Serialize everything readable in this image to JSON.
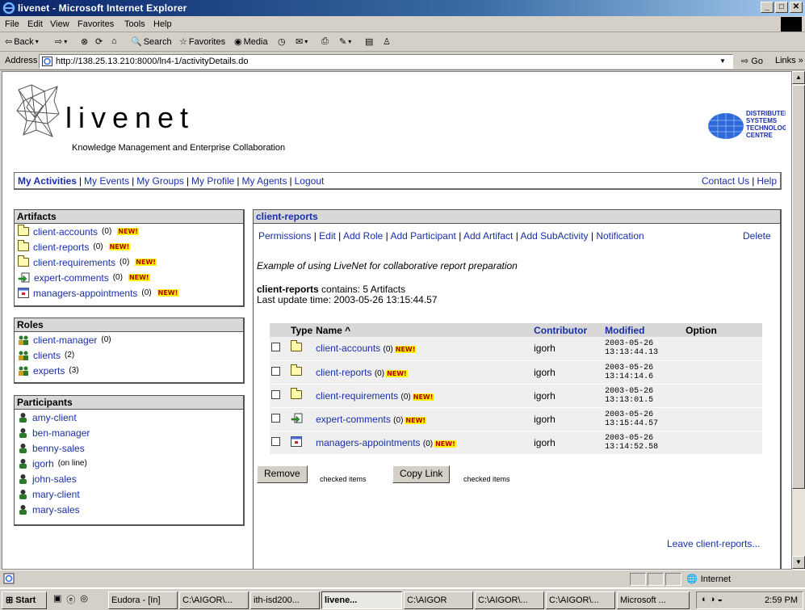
{
  "window": {
    "title": "livenet - Microsoft Internet Explorer",
    "buttons": [
      "_",
      "□",
      "✕"
    ]
  },
  "menu": [
    "File",
    "Edit",
    "View",
    "Favorites",
    "Tools",
    "Help"
  ],
  "toolbar": {
    "back": "Back",
    "search": "Search",
    "favorites": "Favorites",
    "media": "Media"
  },
  "address": {
    "label": "Address",
    "url": "http://138.25.13.210:8000/ln4-1/activityDetails.do",
    "go": "Go",
    "links": "Links »"
  },
  "brand": {
    "name": "livenet",
    "tagline": "Knowledge Management and Enterprise Collaboration",
    "partner": [
      "DISTRIBUTED",
      "SYSTEMS",
      "TECHNOLOGY",
      "CENTRE"
    ]
  },
  "nav": {
    "items": [
      "My Activities",
      "My Events",
      "My Groups",
      "My Profile",
      "My Agents",
      "Logout"
    ],
    "right": [
      "Contact Us",
      "Help"
    ]
  },
  "artifacts": {
    "title": "Artifacts",
    "items": [
      {
        "name": "client-accounts",
        "count": "(0)",
        "badge": "NEW!",
        "icon": "folder-icon"
      },
      {
        "name": "client-reports",
        "count": "(0)",
        "badge": "NEW!",
        "icon": "folder-icon"
      },
      {
        "name": "client-requirements",
        "count": "(0)",
        "badge": "NEW!",
        "icon": "folder-icon"
      },
      {
        "name": "expert-comments",
        "count": "(0)",
        "badge": "NEW!",
        "icon": "arrow-icon"
      },
      {
        "name": "managers-appointments",
        "count": "(0)",
        "badge": "NEW!",
        "icon": "calendar-icon"
      }
    ]
  },
  "roles": {
    "title": "Roles",
    "items": [
      {
        "name": "client-manager",
        "count": "(0)"
      },
      {
        "name": "clients",
        "count": "(2)"
      },
      {
        "name": "experts",
        "count": "(3)"
      }
    ]
  },
  "participants": {
    "title": "Participants",
    "items": [
      {
        "name": "amy-client",
        "note": ""
      },
      {
        "name": "ben-manager",
        "note": ""
      },
      {
        "name": "benny-sales",
        "note": ""
      },
      {
        "name": "igorh",
        "note": "(on line)"
      },
      {
        "name": "john-sales",
        "note": ""
      },
      {
        "name": "mary-client",
        "note": ""
      },
      {
        "name": "mary-sales",
        "note": ""
      }
    ]
  },
  "activity": {
    "title": "client-reports",
    "actions": [
      "Permissions",
      "Edit",
      "Add Role",
      "Add Participant",
      "Add Artifact",
      "Add SubActivity",
      "Notification"
    ],
    "delete": "Delete",
    "description": "Example of using LiveNet for collaborative report preparation",
    "contains_name": "client-reports",
    "contains_text": "contains: 5 Artifacts",
    "last_update": "Last update time: 2003-05-26 13:15:44.57",
    "leave": "Leave client-reports..."
  },
  "table": {
    "headers": [
      "Type",
      "Name ^",
      "Contributor",
      "Modified",
      "Option"
    ],
    "rows": [
      {
        "name": "client-accounts",
        "count": "(0)",
        "badge": "NEW!",
        "contributor": "igorh",
        "date": "2003-05-26",
        "time": "13:13:44.13",
        "icon": "folder-icon"
      },
      {
        "name": "client-reports",
        "count": "(0)",
        "badge": "NEW!",
        "contributor": "igorh",
        "date": "2003-05-26",
        "time": "13:14:14.6",
        "icon": "folder-icon"
      },
      {
        "name": "client-requirements",
        "count": "(0)",
        "badge": "NEW!",
        "contributor": "igorh",
        "date": "2003-05-26",
        "time": "13:13:01.5",
        "icon": "folder-icon"
      },
      {
        "name": "expert-comments",
        "count": "(0)",
        "badge": "NEW!",
        "contributor": "igorh",
        "date": "2003-05-26",
        "time": "13:15:44.57",
        "icon": "arrow-icon"
      },
      {
        "name": "managers-appointments",
        "count": "(0)",
        "badge": "NEW!",
        "contributor": "igorh",
        "date": "2003-05-26",
        "time": "13:14:52.58",
        "icon": "calendar-icon"
      }
    ]
  },
  "buttons": {
    "remove": "Remove",
    "copy": "Copy Link",
    "checked": "checked items"
  },
  "status": {
    "zone": "Internet"
  },
  "taskbar": {
    "start": "Start",
    "tasks": [
      "Eudora - [In]",
      "C:\\AIGOR\\...",
      "ith-isd200...",
      "livene...",
      "C:\\AIGOR",
      "C:\\AIGOR\\...",
      "C:\\AIGOR\\...",
      "Microsoft ..."
    ],
    "clock": "2:59 PM"
  },
  "colors": {
    "link": "#1a2fa8",
    "badge_bg": "#fff200",
    "badge_fg": "#b00000",
    "panel_header": "#d8d8d8"
  }
}
